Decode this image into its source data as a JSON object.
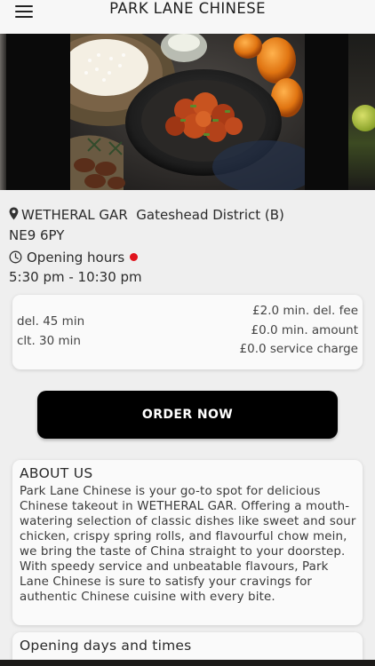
{
  "header": {
    "title": "PARK LANE CHINESE",
    "menu_icon": "hamburger-menu-icon"
  },
  "carousel": {
    "slides": [
      "previous-slide",
      "food-image",
      "next-slide"
    ]
  },
  "location": {
    "icon": "map-pin-icon",
    "street": "WETHERAL GAR",
    "district": "Gateshead District (B)",
    "postcode": "NE9 6PY"
  },
  "hours": {
    "icon": "clock-icon",
    "label": "Opening hours",
    "status_color": "#e0141d",
    "time": "5:30 pm - 10:30 pm"
  },
  "delivery": {
    "delivery_time": "del. 45 min",
    "collection_time": "clt. 30 min",
    "min_delivery_fee": "£2.0 min. del. fee",
    "min_amount": "£0.0 min. amount",
    "service_charge": "£0.0 service charge"
  },
  "order": {
    "button_label": "ORDER NOW"
  },
  "about": {
    "title": "ABOUT US",
    "text": "Park Lane Chinese is your go-to spot for delicious Chinese takeout in WETHERAL GAR. Offering a mouth-watering selection of classic dishes like sweet and sour chicken, crispy spring rolls, and flavourful chow mein, we bring the taste of China straight to your doorstep. With speedy service and unbeatable flavours, Park Lane Chinese is sure to satisfy your cravings for authentic Chinese cuisine with every bite."
  },
  "opening_days": {
    "title": "Opening days and times"
  }
}
